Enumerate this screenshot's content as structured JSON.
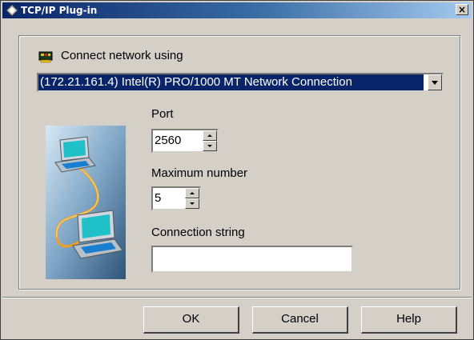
{
  "window": {
    "title": "TCP/IP Plug-in",
    "close_glyph": "×"
  },
  "network": {
    "label": "Connect network using",
    "icon": "network-card-icon",
    "selected": "(172.21.161.4) Intel(R) PRO/1000 MT Network Connection"
  },
  "illustration": {
    "icon": "networked-computers-illustration"
  },
  "port": {
    "label": "Port",
    "value": "2560"
  },
  "maximum": {
    "label": "Maximum number",
    "value": "5"
  },
  "connection_string": {
    "label": "Connection string",
    "value": ""
  },
  "buttons": {
    "ok": "OK",
    "cancel": "Cancel",
    "help": "Help"
  },
  "colors": {
    "titlebar_start": "#0a246a",
    "titlebar_end": "#a6caf0",
    "face": "#d4d0c8",
    "selection": "#0a246a"
  }
}
